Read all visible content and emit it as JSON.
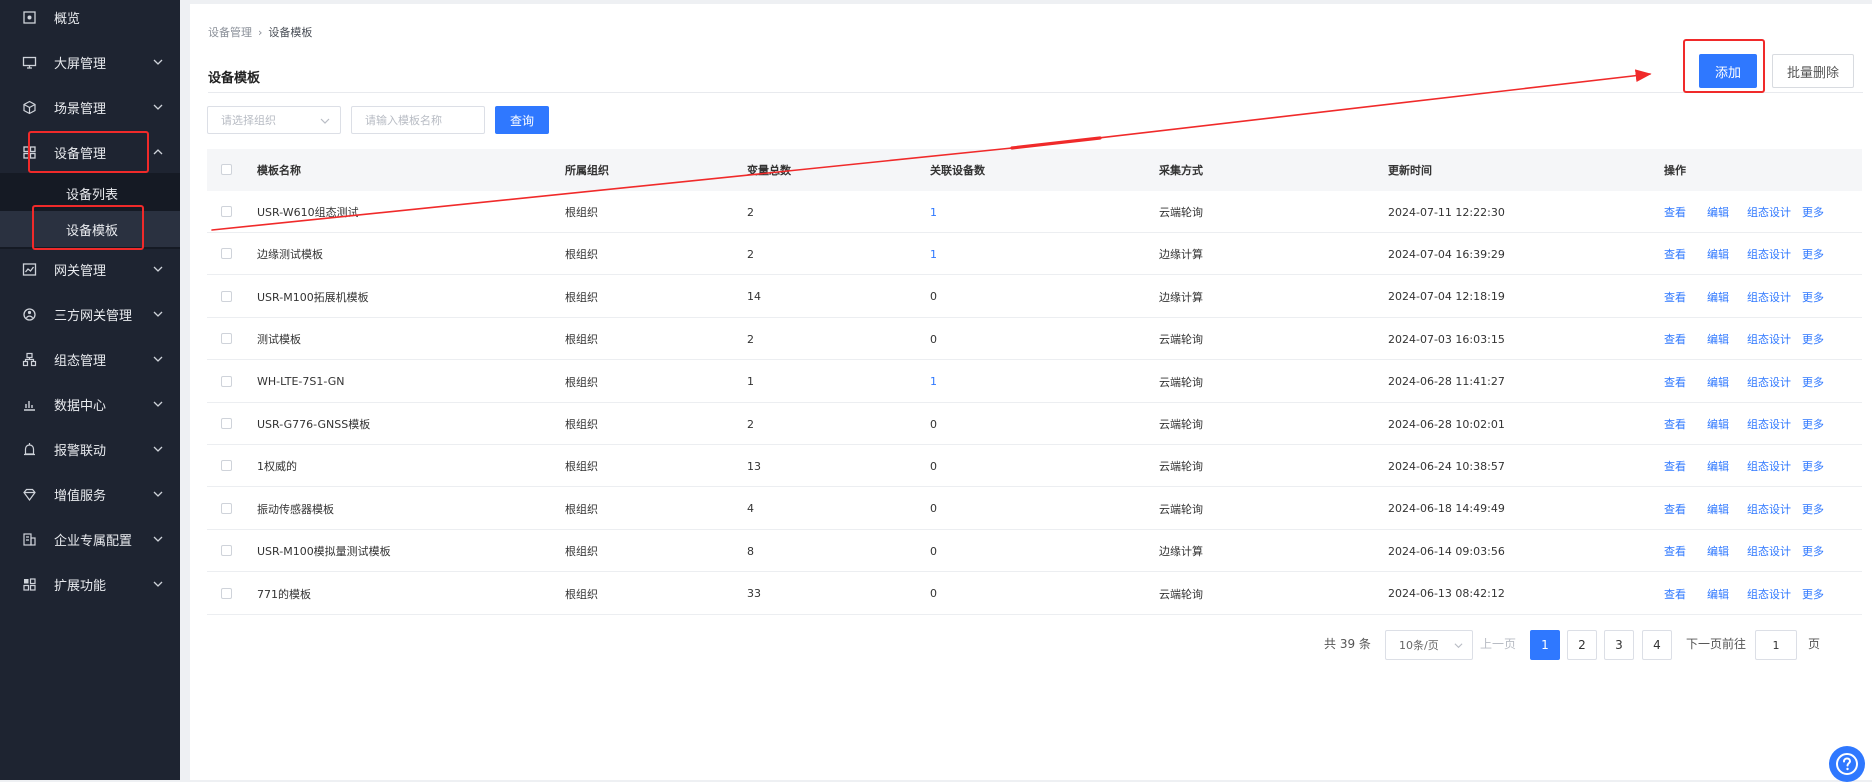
{
  "sidebar": {
    "items": [
      {
        "label": "概览",
        "icon": "overview-icon"
      },
      {
        "label": "大屏管理",
        "icon": "monitor-icon"
      },
      {
        "label": "场景管理",
        "icon": "cube-icon"
      },
      {
        "label": "设备管理",
        "icon": "device-icon"
      },
      {
        "label": "网关管理",
        "icon": "gateway-icon"
      },
      {
        "label": "三方网关管理",
        "icon": "third-party-icon"
      },
      {
        "label": "组态管理",
        "icon": "config-icon"
      },
      {
        "label": "数据中心",
        "icon": "chart-icon"
      },
      {
        "label": "报警联动",
        "icon": "alarm-icon"
      },
      {
        "label": "增值服务",
        "icon": "diamond-icon"
      },
      {
        "label": "企业专属配置",
        "icon": "building-icon"
      },
      {
        "label": "扩展功能",
        "icon": "grid-icon"
      }
    ],
    "submenu": [
      {
        "label": "设备列表"
      },
      {
        "label": "设备模板"
      }
    ]
  },
  "breadcrumb": {
    "parent": "设备管理",
    "separator": "›",
    "current": "设备模板"
  },
  "page_title": "设备模板",
  "toolbar": {
    "add_label": "添加",
    "batch_delete_label": "批量删除"
  },
  "filters": {
    "org_placeholder": "请选择组织",
    "name_placeholder": "请输入模板名称",
    "query_label": "查询"
  },
  "table": {
    "columns": [
      "模板名称",
      "所属组织",
      "变量总数",
      "关联设备数",
      "采集方式",
      "更新时间",
      "操作"
    ],
    "rows": [
      {
        "name": "USR-W610组态测试",
        "org": "根组织",
        "vars": "2",
        "devices": "1",
        "method": "云端轮询",
        "updated": "2024-07-11 12:22:30"
      },
      {
        "name": "边缘测试模板",
        "org": "根组织",
        "vars": "2",
        "devices": "1",
        "method": "边缘计算",
        "updated": "2024-07-04 16:39:29"
      },
      {
        "name": "USR-M100拓展机模板",
        "org": "根组织",
        "vars": "14",
        "devices": "0",
        "method": "边缘计算",
        "updated": "2024-07-04 12:18:19"
      },
      {
        "name": "测试模板",
        "org": "根组织",
        "vars": "2",
        "devices": "0",
        "method": "云端轮询",
        "updated": "2024-07-03 16:03:15"
      },
      {
        "name": "WH-LTE-7S1-GN",
        "org": "根组织",
        "vars": "1",
        "devices": "1",
        "method": "云端轮询",
        "updated": "2024-06-28 11:41:27"
      },
      {
        "name": "USR-G776-GNSS模板",
        "org": "根组织",
        "vars": "2",
        "devices": "0",
        "method": "云端轮询",
        "updated": "2024-06-28 10:02:01"
      },
      {
        "name": "1权威的",
        "org": "根组织",
        "vars": "13",
        "devices": "0",
        "method": "云端轮询",
        "updated": "2024-06-24 10:38:57"
      },
      {
        "name": "振动传感器模板",
        "org": "根组织",
        "vars": "4",
        "devices": "0",
        "method": "云端轮询",
        "updated": "2024-06-18 14:49:49"
      },
      {
        "name": "USR-M100模拟量测试模板",
        "org": "根组织",
        "vars": "8",
        "devices": "0",
        "method": "边缘计算",
        "updated": "2024-06-14 09:03:56"
      },
      {
        "name": "771的模板",
        "org": "根组织",
        "vars": "33",
        "devices": "0",
        "method": "云端轮询",
        "updated": "2024-06-13 08:42:12"
      }
    ],
    "actions": {
      "view": "查看",
      "edit": "编辑",
      "design": "组态设计",
      "more": "更多"
    }
  },
  "pagination": {
    "total_text": "共 39 条",
    "page_size": "10条/页",
    "prev": "上一页",
    "pages": [
      "1",
      "2",
      "3",
      "4"
    ],
    "current_page": "1",
    "next": "下一页",
    "goto_prefix": "前往",
    "goto_value": "1",
    "goto_suffix": "页"
  },
  "colors": {
    "primary": "#2f78ff",
    "sidebar_bg": "#1e2431",
    "annotation_red": "#f02a2a"
  }
}
